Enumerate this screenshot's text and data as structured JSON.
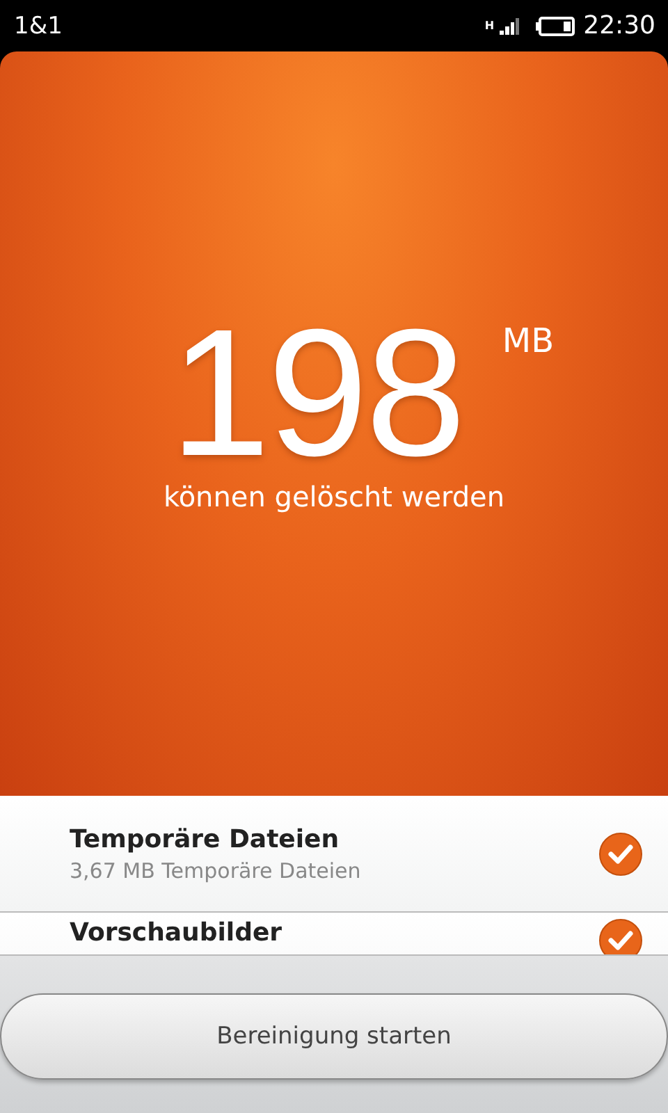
{
  "status_bar": {
    "carrier": "1&1",
    "network": "H",
    "time": "22:30"
  },
  "summary": {
    "amount": "198",
    "unit": "MB",
    "caption": "können gelöscht werden"
  },
  "items": [
    {
      "title": "Temporäre Dateien",
      "subtitle": "3,67 MB Temporäre Dateien",
      "checked": true
    },
    {
      "title": "Vorschaubilder",
      "checked": true
    }
  ],
  "button": "Bereinigung starten"
}
